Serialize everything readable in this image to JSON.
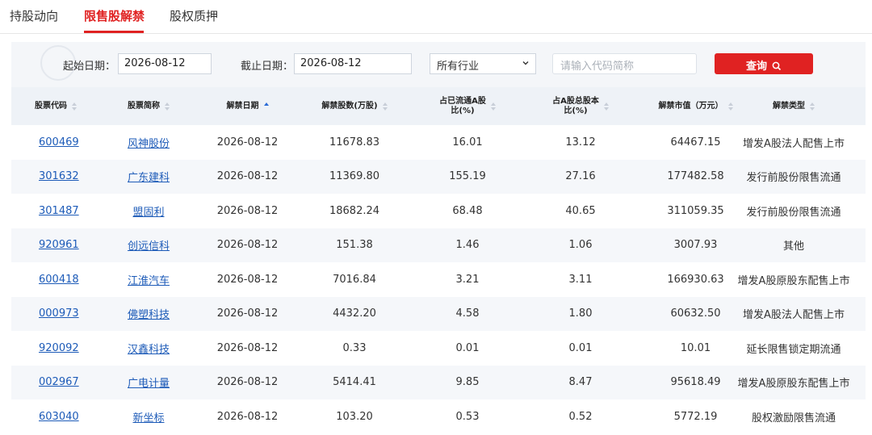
{
  "tabs": [
    {
      "label": "持股动向"
    },
    {
      "label": "限售股解禁"
    },
    {
      "label": "股权质押"
    }
  ],
  "active_tab": "限售股解禁",
  "filter": {
    "start_label": "起始日期：",
    "start_value": "2026-08-12",
    "end_label": "截止日期：",
    "end_value": "2026-08-12",
    "industry_value": "所有行业",
    "search_placeholder": "请输入代码简称",
    "query_label": "查询"
  },
  "table": {
    "headers": [
      "股票代码",
      "股票简称",
      "解禁日期",
      "解禁股数(万股)",
      "占已流通A股比(%)",
      "占A股总股本比(%)",
      "解禁市值（万元）",
      "解禁类型"
    ],
    "header_lines": [
      [
        "股票代码"
      ],
      [
        "股票简称"
      ],
      [
        "解禁日期"
      ],
      [
        "解禁股数(万股)"
      ],
      [
        "占已流通A股",
        "比(%)"
      ],
      [
        "占A股总股本",
        "比(%)"
      ],
      [
        "解禁市值（万元）"
      ],
      [
        "解禁类型"
      ]
    ],
    "sorted_column": "解禁日期",
    "sort_direction": "ascending",
    "rows": [
      [
        "600469",
        "风神股份",
        "2026-08-12",
        "11678.83",
        "16.01",
        "13.12",
        "64467.15",
        "增发A股法人配售上市"
      ],
      [
        "301632",
        "广东建科",
        "2026-08-12",
        "11369.80",
        "155.19",
        "27.16",
        "177482.58",
        "发行前股份限售流通"
      ],
      [
        "301487",
        "盟固利",
        "2026-08-12",
        "18682.24",
        "68.48",
        "40.65",
        "311059.35",
        "发行前股份限售流通"
      ],
      [
        "920961",
        "创远信科",
        "2026-08-12",
        "151.38",
        "1.46",
        "1.06",
        "3007.93",
        "其他"
      ],
      [
        "600418",
        "江淮汽车",
        "2026-08-12",
        "7016.84",
        "3.21",
        "3.11",
        "166930.63",
        "增发A股原股东配售上市"
      ],
      [
        "000973",
        "佛塑科技",
        "2026-08-12",
        "4432.20",
        "4.58",
        "1.80",
        "60632.50",
        "增发A股法人配售上市"
      ],
      [
        "920092",
        "汉鑫科技",
        "2026-08-12",
        "0.33",
        "0.01",
        "0.01",
        "10.01",
        "延长限售锁定期流通"
      ],
      [
        "002967",
        "广电计量",
        "2026-08-12",
        "5414.41",
        "9.85",
        "8.47",
        "95618.49",
        "增发A股原股东配售上市"
      ],
      [
        "603040",
        "新坐标",
        "2026-08-12",
        "103.20",
        "0.53",
        "0.52",
        "5772.19",
        "股权激励限售流通"
      ]
    ]
  },
  "colors": {
    "accent": "#e02222",
    "link": "#1d5bb8",
    "header_bg": "#eef2f7",
    "stripe_bg": "#f5f7fa"
  }
}
